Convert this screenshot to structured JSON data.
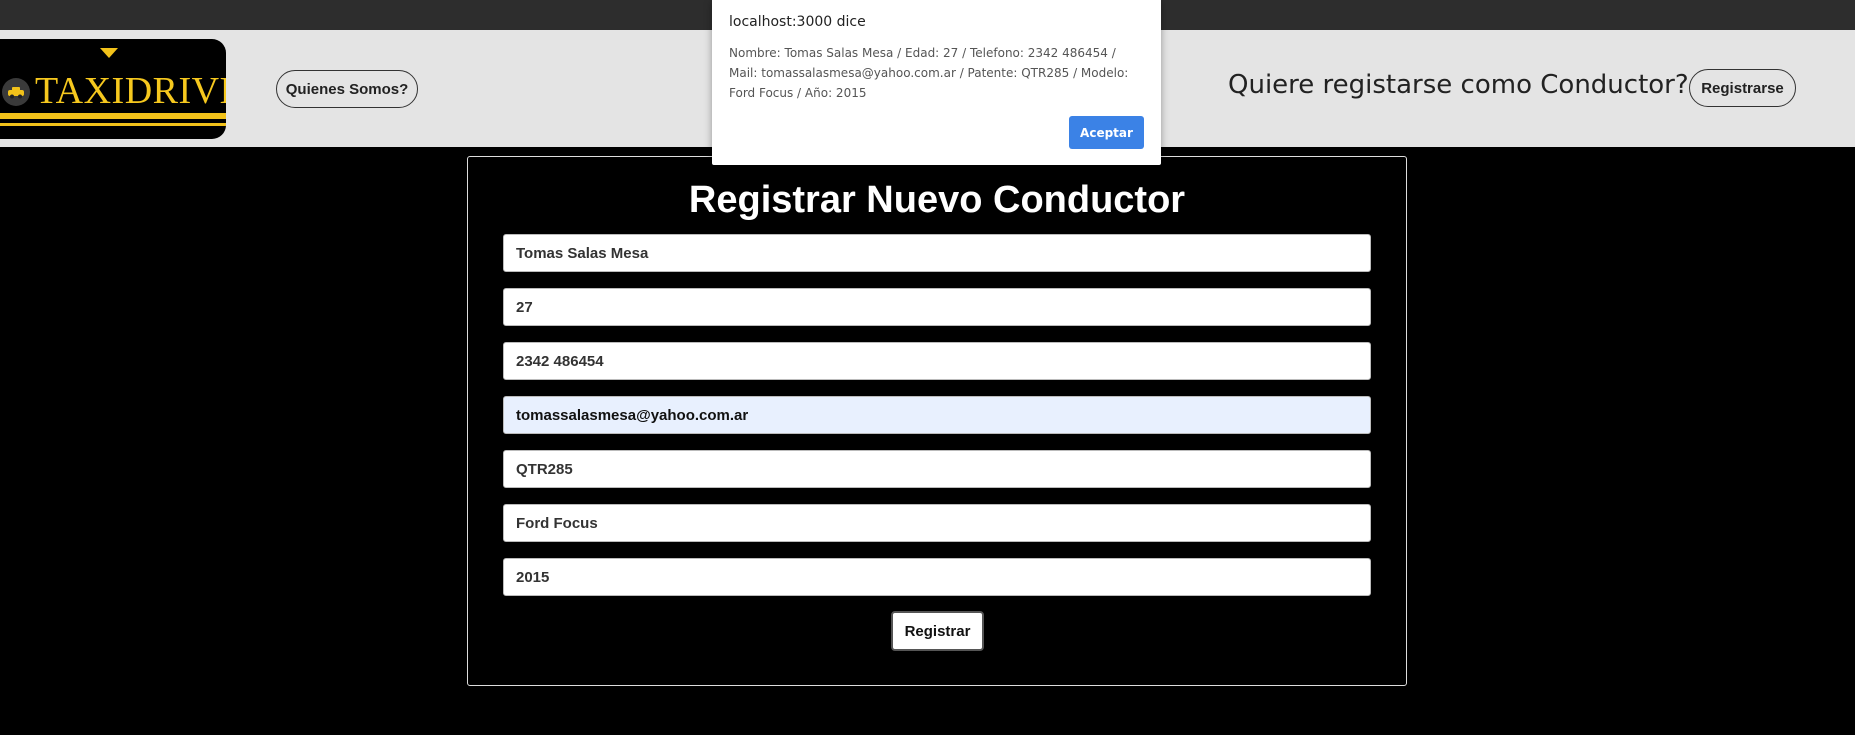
{
  "header": {
    "logo_text": "TAXIDRIVE",
    "about_label": "Quienes Somos?",
    "driver_question": "Quiere registarse como Conductor?",
    "register_label": "Registrarse"
  },
  "form": {
    "title": "Registrar Nuevo Conductor",
    "fields": [
      {
        "name": "nombre",
        "value": "Tomas Salas Mesa"
      },
      {
        "name": "edad",
        "value": "27"
      },
      {
        "name": "telefono",
        "value": "2342 486454"
      },
      {
        "name": "mail",
        "value": "tomassalasmesa@yahoo.com.ar"
      },
      {
        "name": "patente",
        "value": "QTR285"
      },
      {
        "name": "modelo",
        "value": "Ford Focus"
      },
      {
        "name": "anio",
        "value": "2015"
      }
    ],
    "submit_label": "Registrar"
  },
  "dialog": {
    "title": "localhost:3000 dice",
    "message": "Nombre: Tomas Salas Mesa / Edad: 27 / Telefono: 2342 486454 / Mail: tomassalasmesa@yahoo.com.ar / Patente: QTR285 / Modelo: Ford Focus / Año: 2015",
    "accept_label": "Aceptar"
  },
  "colors": {
    "logo_yellow": "#f6c81e",
    "navbar_bg": "#e4e4e4",
    "page_bg": "#000000",
    "dialog_button": "#3b82e6",
    "autofill_bg": "#e8f0fe"
  },
  "icons": {
    "logo_emblem": "taxi-car-icon"
  }
}
